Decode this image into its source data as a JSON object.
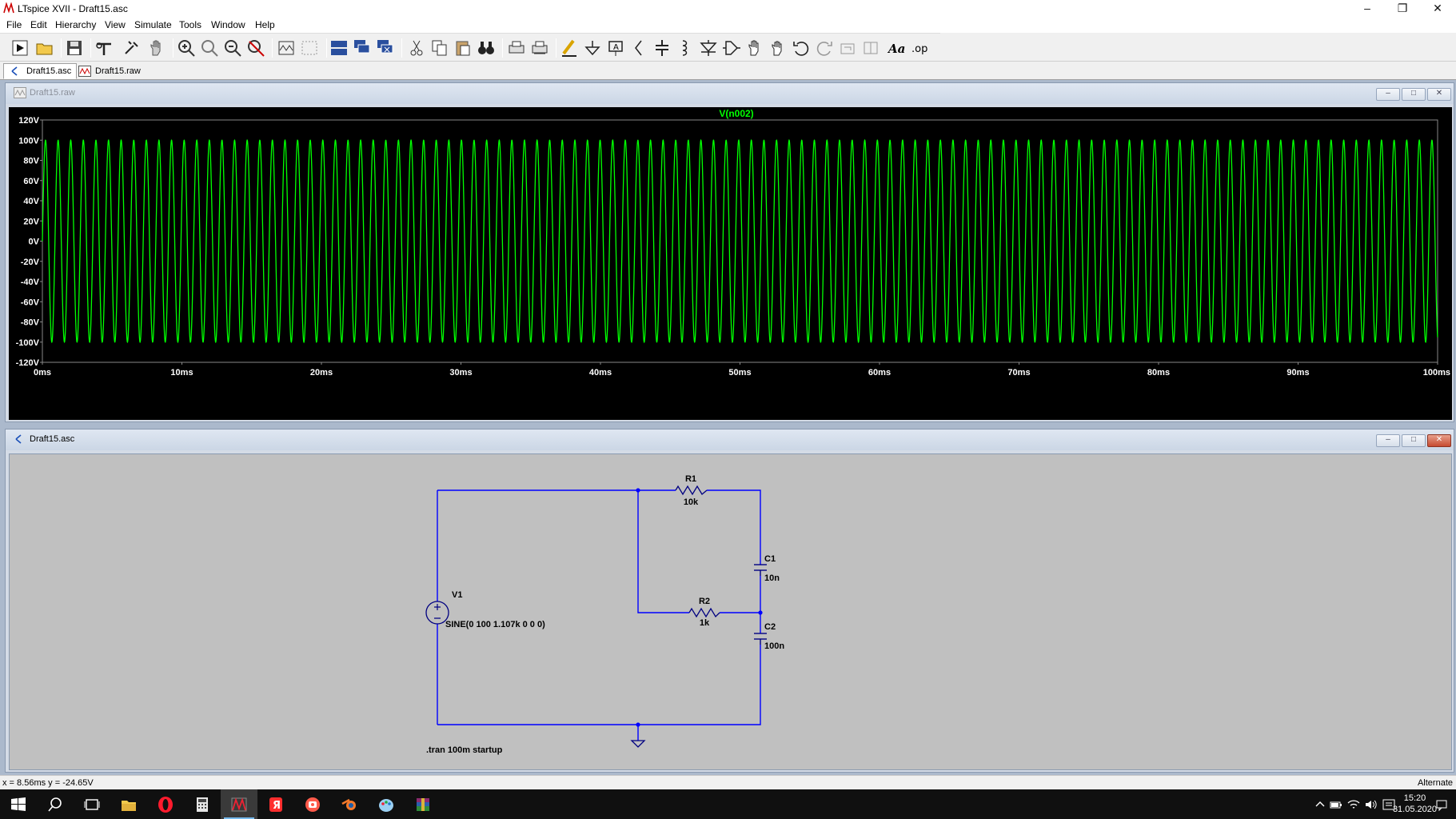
{
  "window": {
    "title": "LTspice XVII - Draft15.asc",
    "icon": "ltspice-logo-icon"
  },
  "menu": [
    "File",
    "Edit",
    "Hierarchy",
    "View",
    "Simulate",
    "Tools",
    "Window",
    "Help"
  ],
  "tabs": [
    {
      "label": "Draft15.asc",
      "icon": "schematic-icon",
      "active": true
    },
    {
      "label": "Draft15.raw",
      "icon": "waveform-icon",
      "active": false
    }
  ],
  "plot_window": {
    "title": "Draft15.raw",
    "trace_label": "V(n002)"
  },
  "schematic_window": {
    "title": "Draft15.asc"
  },
  "chart_data": {
    "type": "line",
    "series": [
      {
        "name": "V(n002)",
        "frequency_hz": 1107,
        "amplitude": 100,
        "offset": 0
      }
    ],
    "xlim": [
      0,
      100
    ],
    "ylim": [
      -120,
      120
    ],
    "xticks": [
      "0ms",
      "10ms",
      "20ms",
      "30ms",
      "40ms",
      "50ms",
      "60ms",
      "70ms",
      "80ms",
      "90ms",
      "100ms"
    ],
    "yticks": [
      "120V",
      "100V",
      "80V",
      "60V",
      "40V",
      "20V",
      "0V",
      "-20V",
      "-40V",
      "-60V",
      "-80V",
      "-100V",
      "-120V"
    ],
    "grid": false,
    "trace_color": "#00ff00",
    "background": "#000000"
  },
  "schematic": {
    "R1": {
      "name": "R1",
      "value": "10k"
    },
    "R2": {
      "name": "R2",
      "value": "1k"
    },
    "C1": {
      "name": "C1",
      "value": "10n"
    },
    "C2": {
      "name": "C2",
      "value": "100n"
    },
    "V1": {
      "name": "V1",
      "value": "SINE(0 100 1.107k 0 0 0)"
    },
    "directive": ".tran 100m startup",
    "wire_color": "#0000ff",
    "component_color": "#000080"
  },
  "status": {
    "coords": "x = 8.56ms    y = -24.65V",
    "mode": "Alternate"
  },
  "taskbar": {
    "time": "15:20",
    "date": "31.05.2020",
    "items": [
      "start-icon",
      "search-icon",
      "task-view-icon",
      "file-explorer-icon",
      "opera-icon",
      "calculator-icon",
      "ltspice-icon",
      "yandex-icon",
      "screenshot-app-icon",
      "blender-icon",
      "paint-icon",
      "winrar-icon"
    ]
  },
  "colors": {
    "accent": "#76b9ed",
    "mdi_background": "#abb9cc"
  }
}
